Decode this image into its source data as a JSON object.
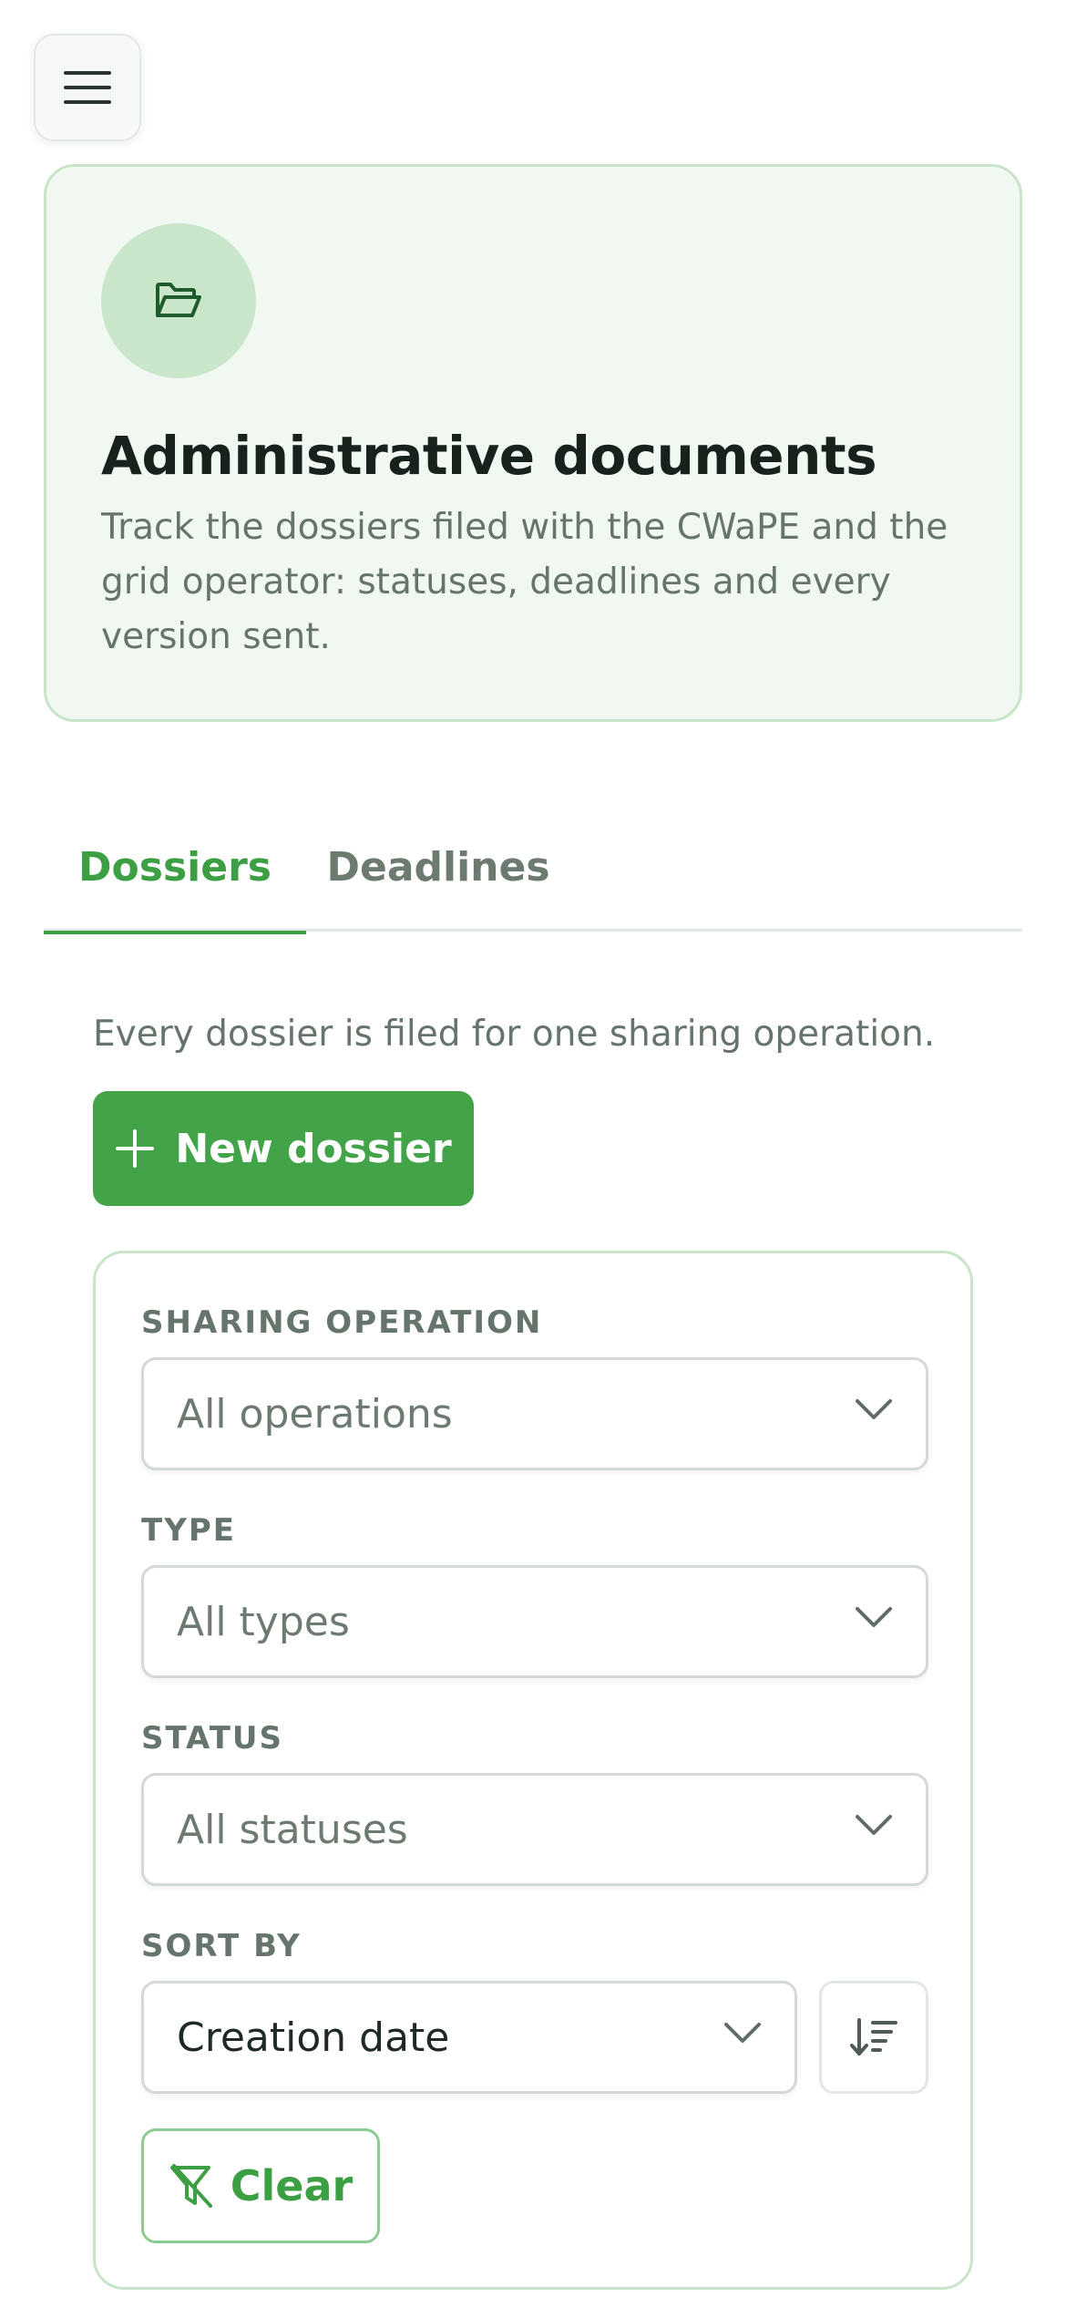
{
  "hero": {
    "icon": "folder-open-icon",
    "title": "Administrative documents",
    "description": "Track the dossiers filed with the CWaPE and the grid operator: statuses, deadlines and every version sent."
  },
  "tabs": [
    {
      "label": "Dossiers",
      "active": true
    },
    {
      "label": "Deadlines",
      "active": false
    }
  ],
  "dossiers": {
    "helper_text": "Every dossier is filed for one sharing operation.",
    "new_button_label": "New dossier"
  },
  "filters": {
    "sharing_operation": {
      "label": "SHARING OPERATION",
      "value": "All operations"
    },
    "type": {
      "label": "TYPE",
      "value": "All types"
    },
    "status": {
      "label": "STATUS",
      "value": "All statuses"
    },
    "sort_by": {
      "label": "SORT BY",
      "value": "Creation date"
    },
    "clear_label": "Clear"
  },
  "colors": {
    "accent": "#42a348",
    "accent_text": "#3d9f44",
    "hero_bg": "#f1f8f1",
    "border_green": "#c8e4c9",
    "muted_text": "#66756b"
  }
}
